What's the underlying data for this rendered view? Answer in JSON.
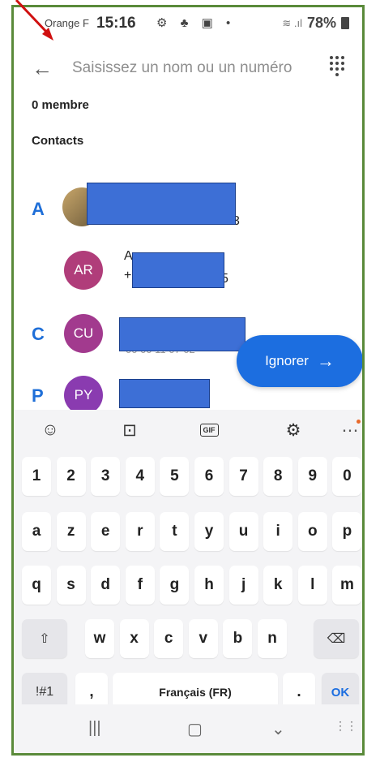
{
  "status_bar": {
    "carrier": "Orange F",
    "time": "15:16",
    "notif_icons": [
      "chrome-icon",
      "teams-icon",
      "gallery-icon",
      "dot-icon"
    ],
    "battery": "78%"
  },
  "search": {
    "placeholder": "Saisissez un nom ou un numéro"
  },
  "members_count": "0 membre",
  "contacts_heading": "Contacts",
  "contacts": [
    {
      "letter": "A",
      "avatar": "",
      "fragment": "3"
    },
    {
      "letter": "",
      "avatar": "AR",
      "fragment_top": "A",
      "fragment_bottom": "+",
      "fragment_end": "5"
    },
    {
      "letter": "C",
      "avatar": "CU",
      "fragment": "00 00 11 07 02"
    },
    {
      "letter": "P",
      "avatar": "PY",
      "fragment": ""
    }
  ],
  "skip_button": {
    "label": "Ignorer"
  },
  "keyboard": {
    "tools": [
      "emoji-icon",
      "sticker-icon",
      "GIF",
      "settings-icon",
      "more-icon"
    ],
    "row_numbers": [
      "1",
      "2",
      "3",
      "4",
      "5",
      "6",
      "7",
      "8",
      "9",
      "0"
    ],
    "row1": [
      "a",
      "z",
      "e",
      "r",
      "t",
      "y",
      "u",
      "i",
      "o",
      "p"
    ],
    "row2": [
      "q",
      "s",
      "d",
      "f",
      "g",
      "h",
      "j",
      "k",
      "l",
      "m"
    ],
    "row3": [
      "w",
      "x",
      "c",
      "v",
      "b",
      "n"
    ],
    "symbols_label": "!#1",
    "comma": ",",
    "space_label": "Français (FR)",
    "period": ".",
    "ok_label": "OK"
  },
  "nav": [
    "recent-apps-icon",
    "home-icon",
    "back-down-icon",
    "keyboard-icon"
  ],
  "colors": {
    "accent": "#1c6ee0",
    "avatar_ar": "#b03d7a",
    "avatar_cu": "#a23a8e",
    "avatar_py": "#8a3bb0",
    "redaction": "#3d6fd6"
  }
}
